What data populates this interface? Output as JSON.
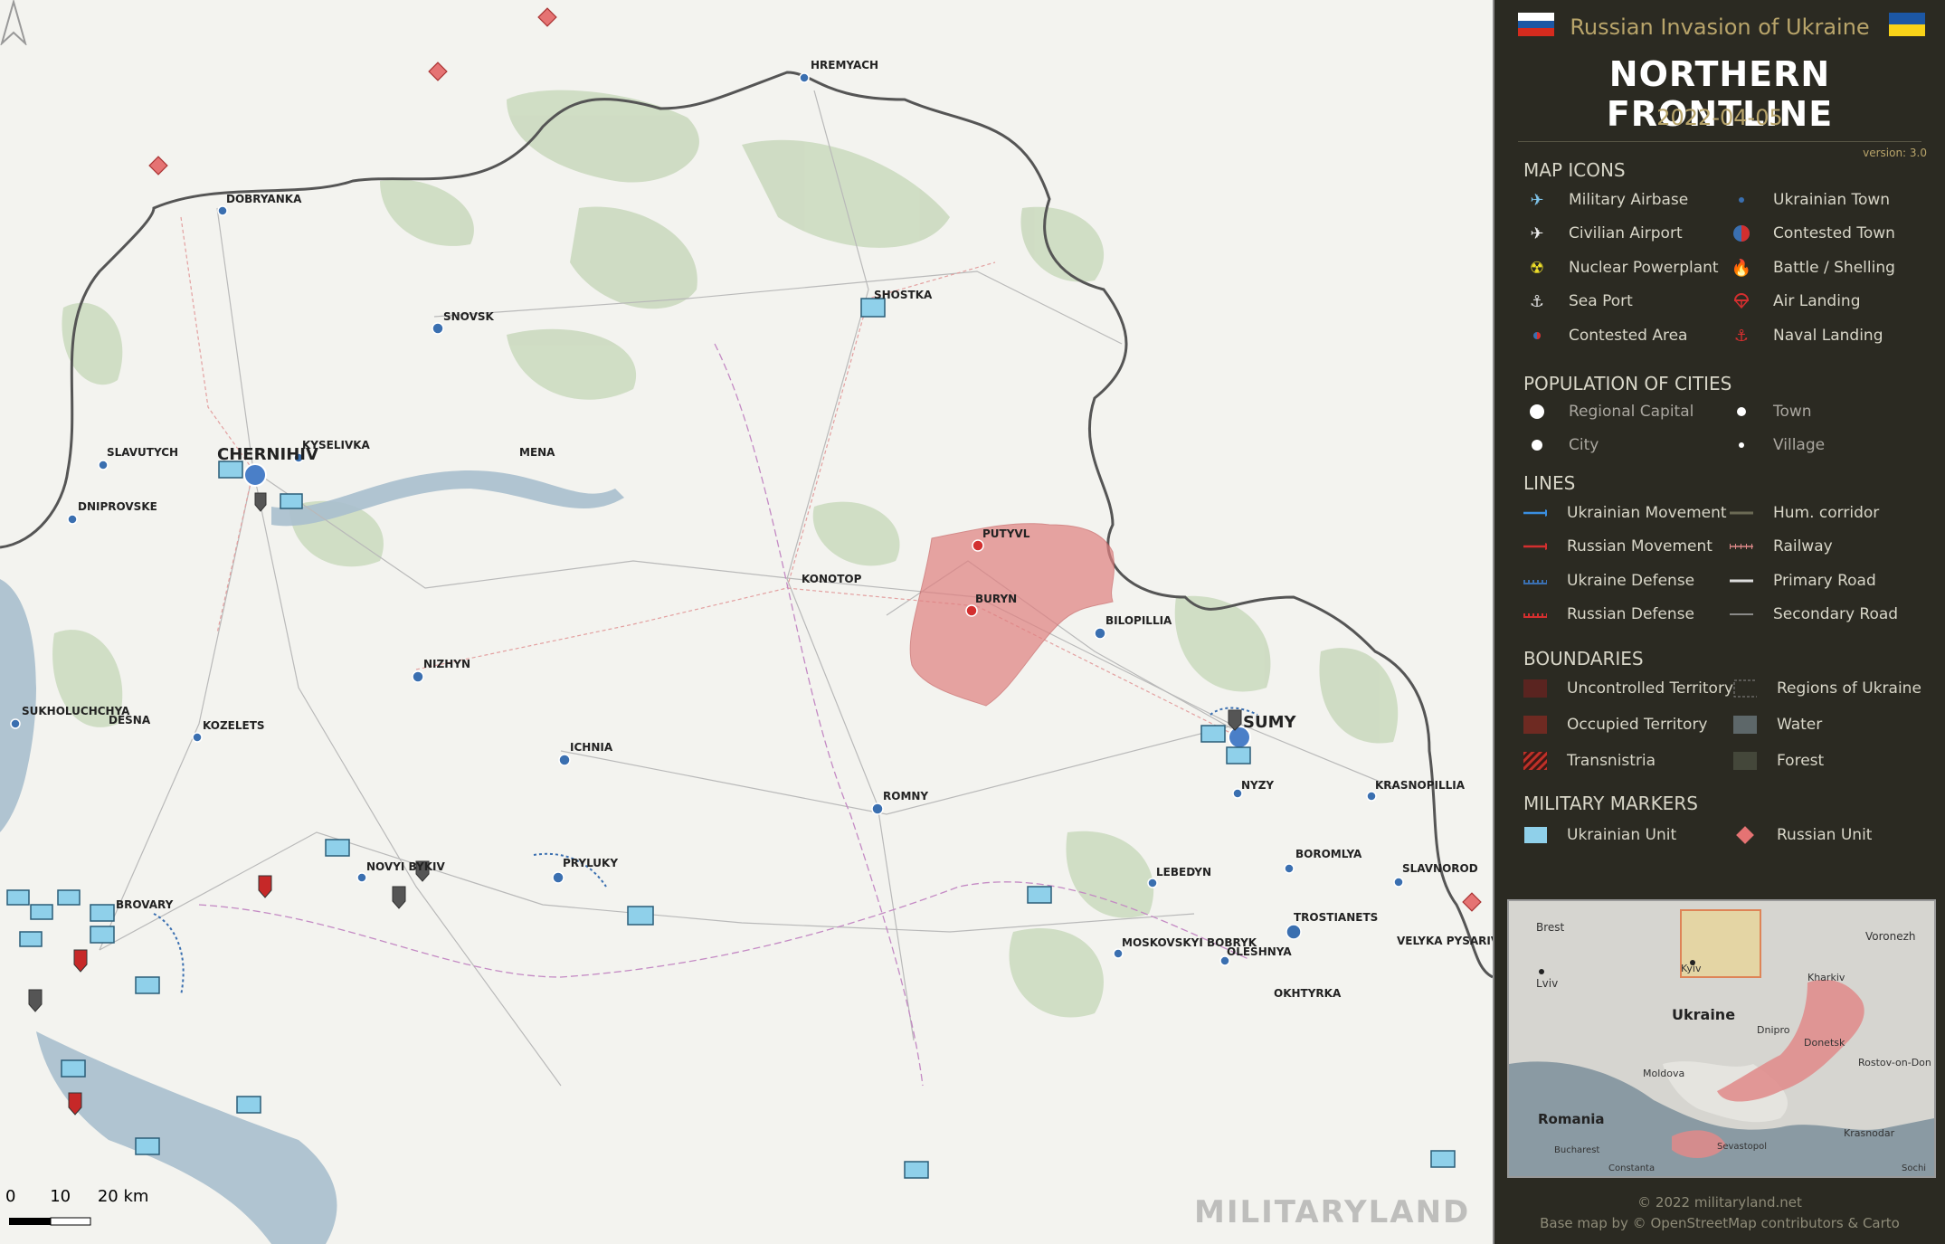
{
  "header": {
    "subtitle": "Russian Invasion of Ukraine",
    "title": "NORTHERN FRONTLINE",
    "date": "2022-04-05",
    "version": "version: 3.0"
  },
  "legend": {
    "map_icons": {
      "heading": "MAP ICONS",
      "left": [
        "Military Airbase",
        "Civilian Airport",
        "Nuclear Powerplant",
        "Sea Port",
        "Contested Area"
      ],
      "right": [
        "Ukrainian Town",
        "Contested Town",
        "Battle / Shelling",
        "Air Landing",
        "Naval Landing"
      ]
    },
    "population": {
      "heading": "POPULATION OF CITIES",
      "left": [
        "Regional Capital",
        "City"
      ],
      "right": [
        "Town",
        "Village"
      ]
    },
    "lines": {
      "heading": "LINES",
      "left": [
        "Ukrainian Movement",
        "Russian Movement",
        "Ukraine Defense",
        "Russian Defense"
      ],
      "right": [
        "Hum. corridor",
        "Railway",
        "Primary Road",
        "Secondary Road"
      ]
    },
    "boundaries": {
      "heading": "BOUNDARIES",
      "left": [
        "Uncontrolled Territory",
        "Occupied Territory",
        "Transnistria"
      ],
      "right": [
        "Regions of Ukraine",
        "Water",
        "Forest"
      ]
    },
    "markers": {
      "heading": "MILITARY MARKERS",
      "left": [
        "Ukrainian Unit"
      ],
      "right": [
        "Russian Unit"
      ]
    }
  },
  "inset": {
    "labels": [
      "Brest",
      "Voronezh",
      "Lviv",
      "Kyiv",
      "Kharkiv",
      "Ukraine",
      "Dnipro",
      "Donetsk",
      "Rostov-on-Don",
      "Moldova",
      "Romania",
      "Krasnodar",
      "Sevastopol",
      "Bucharest",
      "Constanta",
      "Sochi"
    ]
  },
  "map": {
    "cities": {
      "hremyach": "HREMYACH",
      "dobryanka": "DOBRYANKA",
      "shostka": "SHOSTKA",
      "snovsk": "SNOVSK",
      "slavutych": "SLAVUTYCH",
      "chernihiv": "CHERNIHIV",
      "kyselivka": "KYSELIVKA",
      "mena": "MENA",
      "dniprovske": "DNIPROVSKE",
      "putyvl": "PUTYVL",
      "konotop": "KONOTOP",
      "buryn": "BURYN",
      "bilopillia": "BILOPILLIA",
      "nizhyn": "NIZHYN",
      "sukholuchchya": "SUKHOLUCHCHYA",
      "desna": "DESNA",
      "kozelets": "KOZELETS",
      "sumy": "SUMY",
      "ichnia": "ICHNIA",
      "nyzy": "NYZY",
      "krasnopillia": "KRASNOPILLIA",
      "romny": "ROMNY",
      "novyi_bykiv": "NOVYI BYKIV",
      "prylyky": "PRYLUKY",
      "boromlya": "BOROMLYA",
      "slavnorod": "SLAVNOROD",
      "brovary": "BROVARY",
      "lebedyn": "LEBEDYN",
      "trostianets": "TROSTIANETS",
      "moskovskyi_bobryk": "MOSKOVSKYI BOBRYK",
      "oleshnya": "OLESHNYA",
      "velyka_pysarivka": "VELYKA PYSARIVKA",
      "okhtyrka": "OKHTYRKA"
    },
    "scale": [
      "0",
      "10",
      "20 km"
    ],
    "watermark": "MILITARYLAND"
  },
  "footer": {
    "copyright": "© 2022 militaryland.net",
    "basemap": "Base map by © OpenStreetMap contributors & Carto"
  },
  "colors": {
    "panel_bg": "#2b2a22",
    "accent": "#b8a46a",
    "occupied": "#e08080",
    "ukrainian_unit": "#8fd0ea",
    "russian_unit": "#e57373",
    "ukr_town": "#3a6fb0",
    "contested_town": "#d32f2f"
  }
}
